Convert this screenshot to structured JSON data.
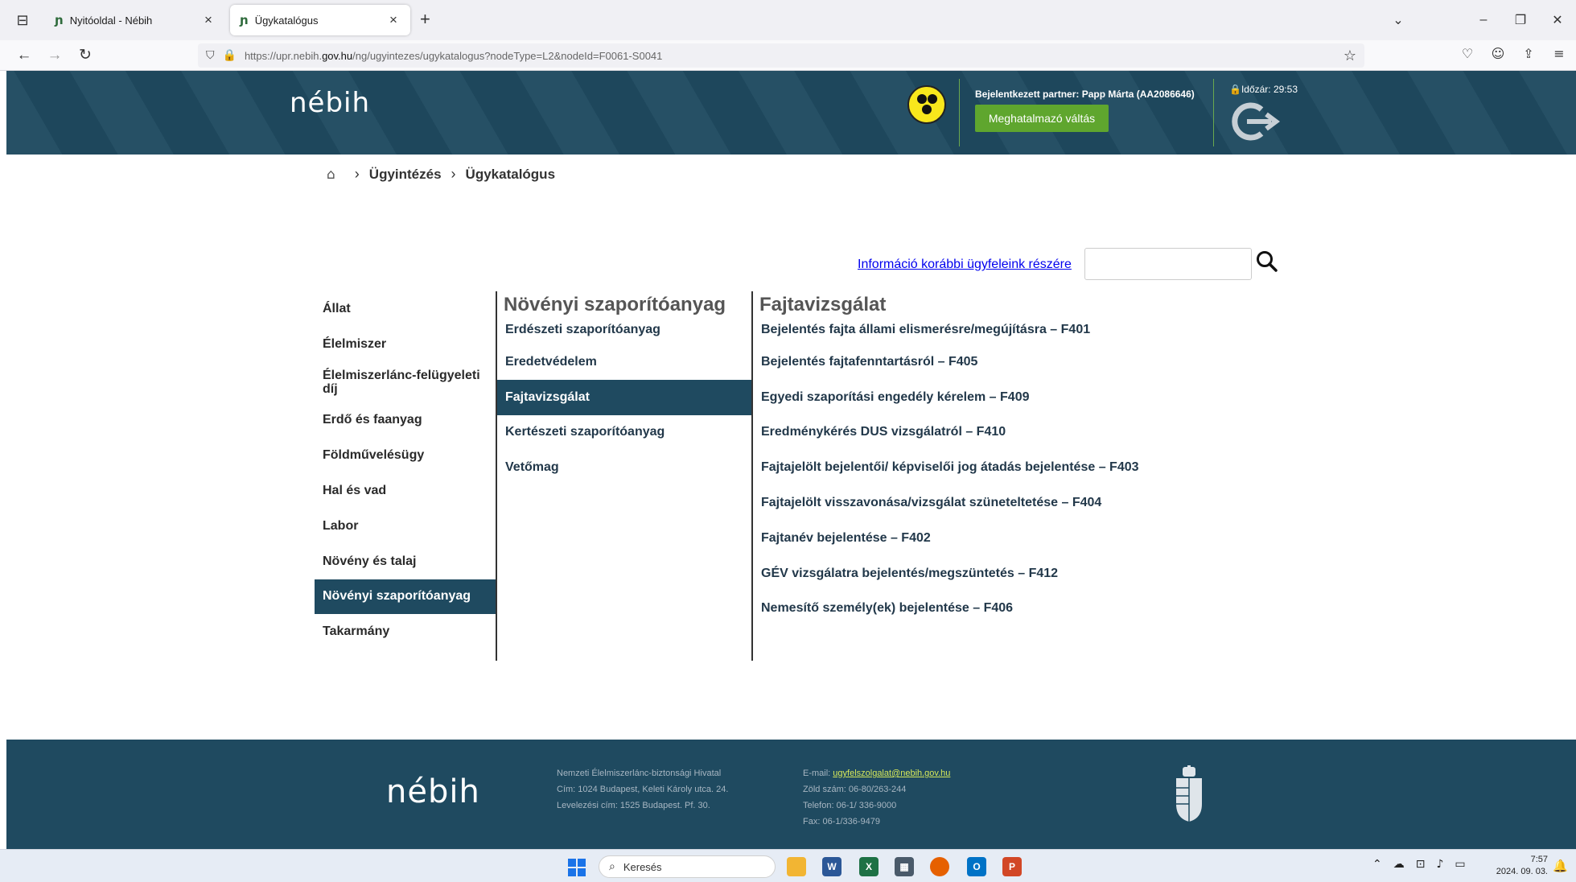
{
  "browser": {
    "tabs": [
      {
        "title": "Nyitóoldal - Nébih"
      },
      {
        "title": "Ügykatalógus"
      }
    ],
    "url_prefix": "https://upr.nebih.",
    "url_domain": "gov.hu",
    "url_path": "/ng/ugyintezes/ugykatalogus?nodeType=L2&nodeId=F0061-S0041"
  },
  "header": {
    "logo_text": "nébih",
    "partner_text": "Bejelentkezett partner: Papp Márta (AA2086646)",
    "switch_button": "Meghatalmazó váltás",
    "timer_text": "🔒Időzár: 29:53"
  },
  "breadcrumb": {
    "items": [
      "Ügyintézés",
      "Ügykatalógus"
    ]
  },
  "search": {
    "info_link": "Információ korábbi ügyfeleink részére",
    "placeholder": ""
  },
  "catalog": {
    "categories": [
      "Állat",
      "Élelmiszer",
      "Élelmiszerlánc-felügyeleti díj",
      "Erdő és faanyag",
      "Földművelésügy",
      "Hal és vad",
      "Labor",
      "Növény és talaj",
      "Növényi szaporítóanyag",
      "Takarmány"
    ],
    "selected_category": "Növényi szaporítóanyag",
    "sub_title": "Növényi szaporítóanyag",
    "subcategories": [
      "Erdészeti szaporítóanyag",
      "Eredetvédelem",
      "Fajtavizsgálat",
      "Kertészeti szaporítóanyag",
      "Vetőmag"
    ],
    "selected_subcategory": "Fajtavizsgálat",
    "proc_title": "Fajtavizsgálat",
    "procedures": [
      "Bejelentés fajta állami elismerésre/megújításra – F401",
      "Bejelentés fajtafenntartásról – F405",
      "Egyedi szaporítási engedély kérelem – F409",
      "Eredménykérés DUS vizsgálatról – F410",
      "Fajtajelölt bejelentői/ képviselői jog átadás bejelentése – F403",
      "Fajtajelölt visszavonása/vizsgálat szüneteltetése – F404",
      "Fajtanév bejelentése – F402",
      "GÉV vizsgálatra bejelentés/megszüntetés – F412",
      "Nemesítő személy(ek) bejelentése – F406"
    ]
  },
  "footer": {
    "logo_text": "nébih",
    "org_name": "Nemzeti Élelmiszerlánc-biztonsági Hivatal",
    "address": "Cím: 1024 Budapest, Keleti Károly utca. 24.",
    "postal": "Levelezési cím: 1525 Budapest. Pf. 30.",
    "email_label": "E-mail: ",
    "email": "ugyfelszolgalat@nebih.gov.hu",
    "green_number": "Zöld szám: 06-80/263-244",
    "phone": "Telefon: 06-1/ 336-9000",
    "fax": "Fax: 06-1/336-9479"
  },
  "taskbar": {
    "search_label": "Keresés",
    "time": "7:57",
    "date": "2024. 09. 03."
  },
  "colors": {
    "brand_dark": "#1f4a60",
    "brand_green": "#5fa62e",
    "logo_accent": "#8cc63f",
    "link": "#0000ee"
  }
}
